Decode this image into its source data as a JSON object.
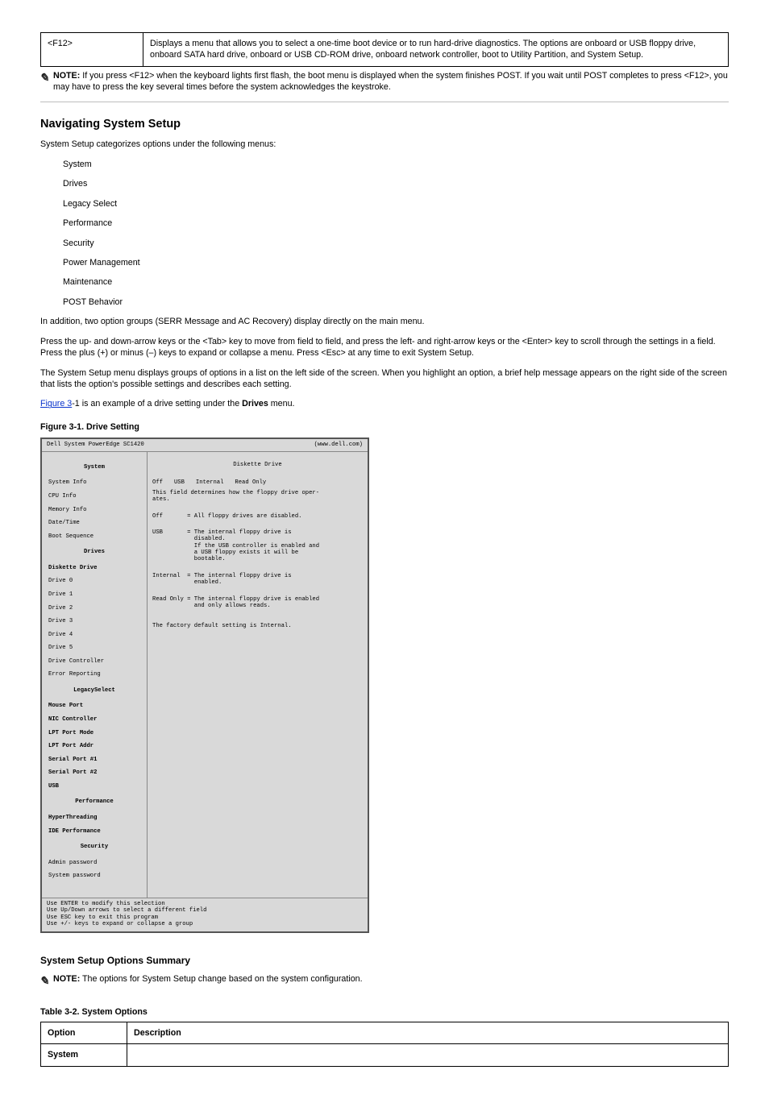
{
  "top_table": {
    "option": "<F12>",
    "desc_line1": "Displays a menu that allows you to select a one-time boot device or to run hard-drive diagnostics. The options are onboard or USB floppy drive,",
    "desc_line2": "onboard SATA hard drive, onboard or USB CD-ROM drive, onboard network controller, boot to Utility Partition, and System Setup."
  },
  "note1": {
    "label": "NOTE:",
    "text": " If you press <F12> when the keyboard lights first flash, the boot menu is displayed when the system finishes POST. If you wait until POST completes to press <F12>, you may have to press the key several times before the system acknowledges the keystroke."
  },
  "nav": {
    "heading": "Navigating System Setup",
    "p1": "System Setup categorizes options under the following menus:",
    "p2": "In addition, two option groups (SERR Message and AC Recovery) display directly on the main menu.",
    "p3_a": "Press the up- and down-arrow keys or the <Tab> key to move from field to field, and press the left-",
    "p3_b": " and right-arrow keys or the <Enter> key to scroll through the settings in a field. Press the plus (+) or minus (–) keys to expand or collapse a menu. Press <Esc> at any time to exit System Setup.",
    "p4": "The System Setup menu displays groups of options in a list on the left side of the screen. When you highlight an option, a brief help message appears on the right side of the screen that lists the option's possible settings and describes each setting.",
    "list": [
      "System",
      "Drives",
      "Legacy Select",
      "Performance",
      "Security",
      "Power Management",
      "Maintenance",
      "POST Behavior"
    ],
    "fig_ref_a": "Figure 3",
    "fig_ref_b": "-1 is an example of a drive setting under the ",
    "fig_ref_c": "Drives",
    "fig_ref_d": " menu.",
    "fig_caption": "Figure 3-1. Drive Setting"
  },
  "bios": {
    "product": "Dell System PowerEdge SC1420",
    "url": "(www.dell.com)",
    "left_cats": {
      "System": "System",
      "Drives": "Drives",
      "Legacy": "LegacySelect",
      "Performance": "Performance",
      "Security": "Security"
    },
    "left_items": {
      "si": "System Info",
      "cpu": "CPU Info",
      "mem": "Memory Info",
      "dt": "Date/Time",
      "bs": "Boot Sequence",
      "dd": "Diskette Drive",
      "d0": "Drive 0",
      "d1": "Drive 1",
      "d2": "Drive 2",
      "d3": "Drive 3",
      "d4": "Drive 4",
      "d5": "Drive 5",
      "dc": "Drive Controller",
      "er": "Error Reporting",
      "mp": "Mouse Port",
      "nic": "NIC Controller",
      "lpm": "LPT Port Mode",
      "lpa": "LPT Port Addr",
      "sp1": "Serial Port #1",
      "sp2": "Serial Port #2",
      "usb": "USB",
      "ht": "HyperThreading",
      "ide": "IDE Performance",
      "ap": "Admin password",
      "sp": "System password"
    },
    "right": {
      "title": "Diskette Drive",
      "opt_off": "Off",
      "opt_usb": "USB",
      "opt_int": "Internal",
      "opt_ro": "Read Only",
      "intro": "This field determines how the floppy drive oper-\nates.",
      "line_off": "Off       = All floppy drives are disabled.",
      "line_usb": "USB       = The internal floppy drive is\n            disabled.\n            If the USB controller is enabled and\n            a USB floppy exists it will be\n            bootable.",
      "line_int": "Internal  = The internal floppy drive is\n            enabled.",
      "line_ro": "Read Only = The internal floppy drive is enabled\n            and only allows reads.",
      "default": "The factory default setting is Internal."
    },
    "help": "Use ENTER to modify this selection\nUse Up/Down arrows to select a different field\nUse ESC key to exit this program\nUse +/- keys to expand or collapse a group"
  },
  "summary": {
    "heading": "System Setup Options Summary",
    "note_label": "NOTE:",
    "note_text": " The options for System Setup change based on the system configuration.",
    "table_caption": "Table 3-2. System Options",
    "col_option": "Option",
    "col_description": "Description",
    "row_system": "System"
  }
}
